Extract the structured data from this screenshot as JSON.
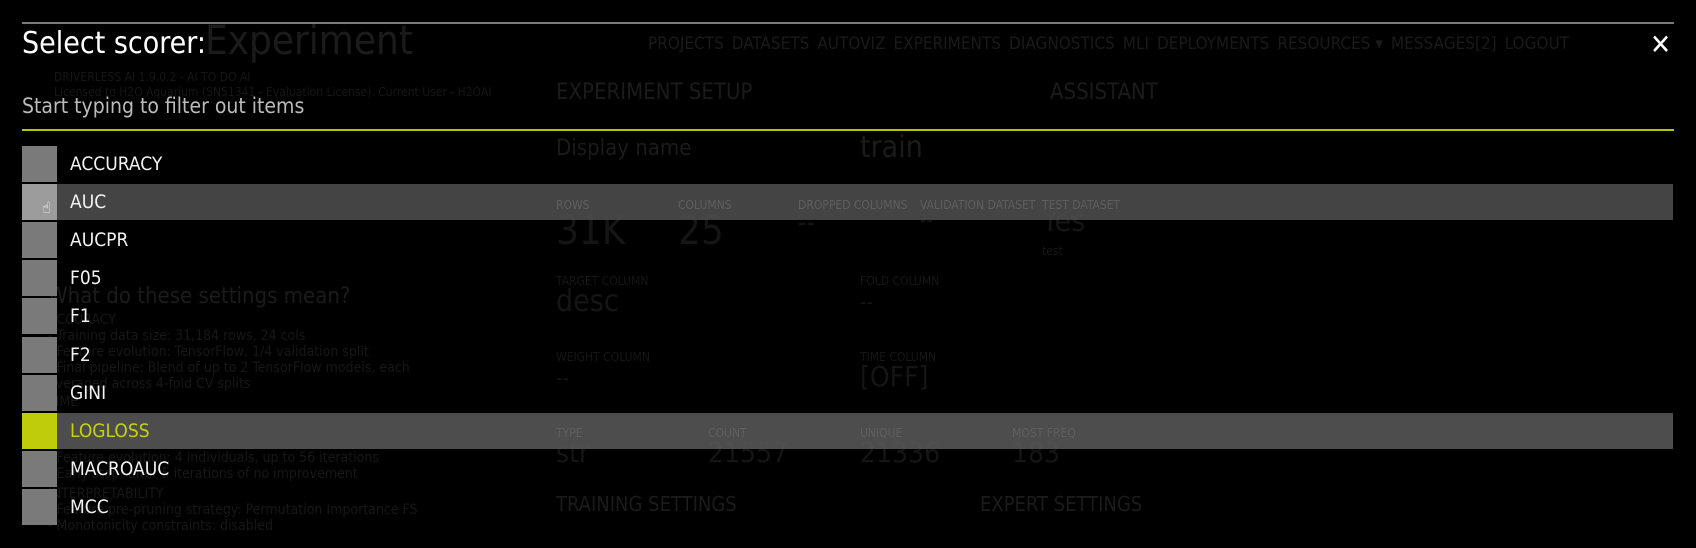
{
  "background": {
    "app_title": "Experiment",
    "version": "DRIVERLESS AI 1.9.0.2 - AI TO DO AI",
    "license": "Licensed to H2O Aquarium (SN51341 - Evaluation License). Current User - H2OAI",
    "nav": [
      "PROJECTS",
      "DATASETS",
      "AUTOVIZ",
      "EXPERIMENTS",
      "DIAGNOSTICS",
      "MLI",
      "DEPLOYMENTS",
      "RESOURCES ▾",
      "MESSAGES[2]",
      "LOGOUT"
    ],
    "setup_title": "EXPERIMENT SETUP",
    "assistant": "ASSISTANT",
    "display_name_placeholder": "Display name",
    "dataset_value": "train",
    "stats": [
      {
        "label": "ROWS",
        "value": "31K"
      },
      {
        "label": "COLUMNS",
        "value": "25"
      },
      {
        "label": "DROPPED COLUMNS",
        "value": "--"
      },
      {
        "label": "VALIDATION DATASET",
        "value": "--"
      },
      {
        "label": "TEST DATASET",
        "value": "Yes"
      }
    ],
    "test_name": "test",
    "target_label": "TARGET COLUMN",
    "target_value": "desc",
    "fold_label": "FOLD COLUMN",
    "fold_value": "--",
    "weight_label": "WEIGHT COLUMN",
    "weight_value": "--",
    "time_label": "TIME COLUMN",
    "time_value": "[OFF]",
    "target_stats": [
      {
        "label": "TYPE",
        "value": "str"
      },
      {
        "label": "COUNT",
        "value": "21557"
      },
      {
        "label": "UNIQUE",
        "value": "21336"
      },
      {
        "label": "MOST FREQ",
        "value": "183"
      }
    ],
    "training_settings": "TRAINING SETTINGS",
    "expert_settings": "EXPERT SETTINGS",
    "help_title": "What do these settings mean?",
    "help_lines": [
      "ACCURACY",
      "- Training data size: 31,184 rows, 24 cols",
      "- Feature evolution: TensorFlow, 1/4 validation split",
      "- Final pipeline: Blend of up to 2 TensorFlow models, each",
      "averaged across 4-fold CV splits",
      "TIME",
      "- Feature evolution: 4 individuals, up to 56 iterations",
      "- Early stop: after 5 iterations of no improvement",
      "INTERPRETABILITY",
      "- Feature pre-pruning strategy: Permutation Importance FS",
      "- Monotonicity constraints: disabled"
    ]
  },
  "dialog": {
    "title": "Select scorer:",
    "filter_placeholder": "Start typing to filter out items",
    "close_icon": "close-x-icon",
    "accent_color": "#bfcc0a",
    "items": [
      "ACCURACY",
      "AUC",
      "AUCPR",
      "F05",
      "F1",
      "F2",
      "GINI",
      "LOGLOSS",
      "MACROAUC",
      "MCC"
    ],
    "selected": "LOGLOSS",
    "hovered": "AUC"
  }
}
